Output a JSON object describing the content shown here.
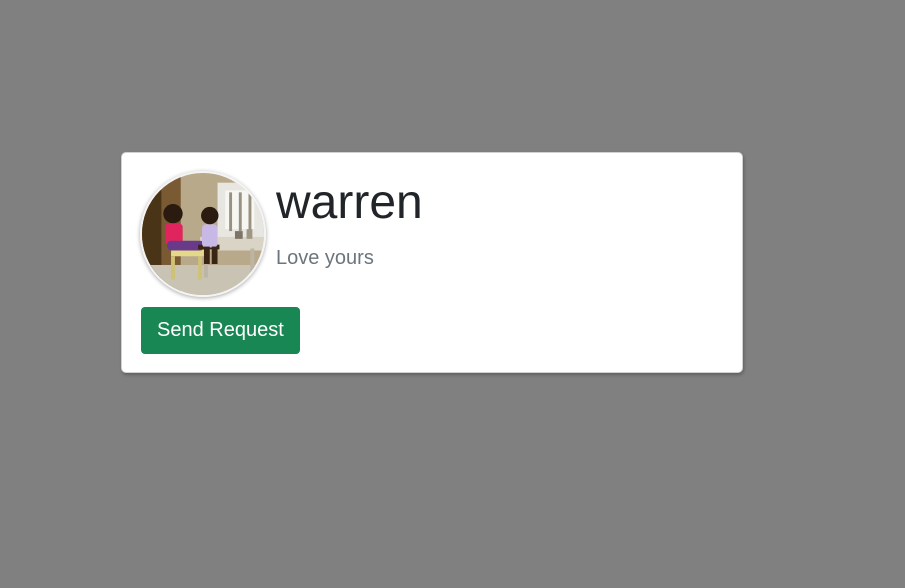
{
  "profile": {
    "username": "warren",
    "bio": "Love yours",
    "avatar_alt": "profile-photo"
  },
  "actions": {
    "send_request_label": "Send Request"
  },
  "colors": {
    "background": "#808080",
    "card": "#ffffff",
    "button": "#198754",
    "bio_text": "#6c757d"
  }
}
